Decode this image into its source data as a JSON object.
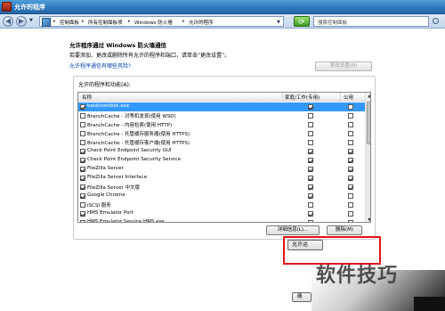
{
  "window": {
    "title": "允许的程序"
  },
  "nav": {
    "back": "◀",
    "forward": "▶",
    "breadcrumb": [
      "控制面板",
      "所有控制面板项",
      "Windows 防火墙",
      "允许的程序"
    ],
    "search_placeholder": "搜索控制面板"
  },
  "content": {
    "heading": "允许程序通过 Windows 防火墙通信",
    "subtext": "若要添加、更改或删除所有允许的程序和端口，请单击“更改设置”。",
    "risk_link": "允许程序通信有哪些风险?",
    "change_settings": "更改设置(N)",
    "group_label": "允许的程序和功能(A):",
    "columns": {
      "name": "名称",
      "home": "家庭/工作(专用)",
      "public": "公用"
    },
    "rows": [
      {
        "name": "baidunetdisk.exe",
        "enabled": true,
        "home": true,
        "public": false,
        "selected": true
      },
      {
        "name": "BranchCache - 对等机发现(使用 WSD)",
        "enabled": false,
        "home": false,
        "public": false
      },
      {
        "name": "BranchCache - 内容检索(使用 HTTP)",
        "enabled": false,
        "home": false,
        "public": false
      },
      {
        "name": "BranchCache - 托管缓存服务器(使用 HTTPS)",
        "enabled": false,
        "home": false,
        "public": false
      },
      {
        "name": "BranchCache - 托管缓存客户端(使用 HTTPS)",
        "enabled": false,
        "home": false,
        "public": false
      },
      {
        "name": "Check Point Endpoint Security GUI",
        "enabled": true,
        "home": true,
        "public": true
      },
      {
        "name": "Check Point Endpoint Security Service",
        "enabled": true,
        "home": true,
        "public": true
      },
      {
        "name": "FileZilla Server",
        "enabled": true,
        "home": true,
        "public": true
      },
      {
        "name": "FileZilla Server Interface",
        "enabled": true,
        "home": true,
        "public": true
      },
      {
        "name": "FileZilla Server 中文版",
        "enabled": true,
        "home": true,
        "public": true
      },
      {
        "name": "Google Chrome",
        "enabled": true,
        "home": true,
        "public": false
      },
      {
        "name": "iSCSI 服务",
        "enabled": false,
        "home": false,
        "public": false
      },
      {
        "name": "HMS Emulator Port",
        "enabled": true,
        "home": true,
        "public": false
      },
      {
        "name": "HMS Emulator Service HMS.exe",
        "enabled": true,
        "home": true,
        "public": false
      }
    ],
    "details_button": "详细信息(L)...",
    "remove_button": "删除(M)",
    "allow_another": "允许运",
    "ok_button": "确"
  },
  "watermark": "软件技巧"
}
